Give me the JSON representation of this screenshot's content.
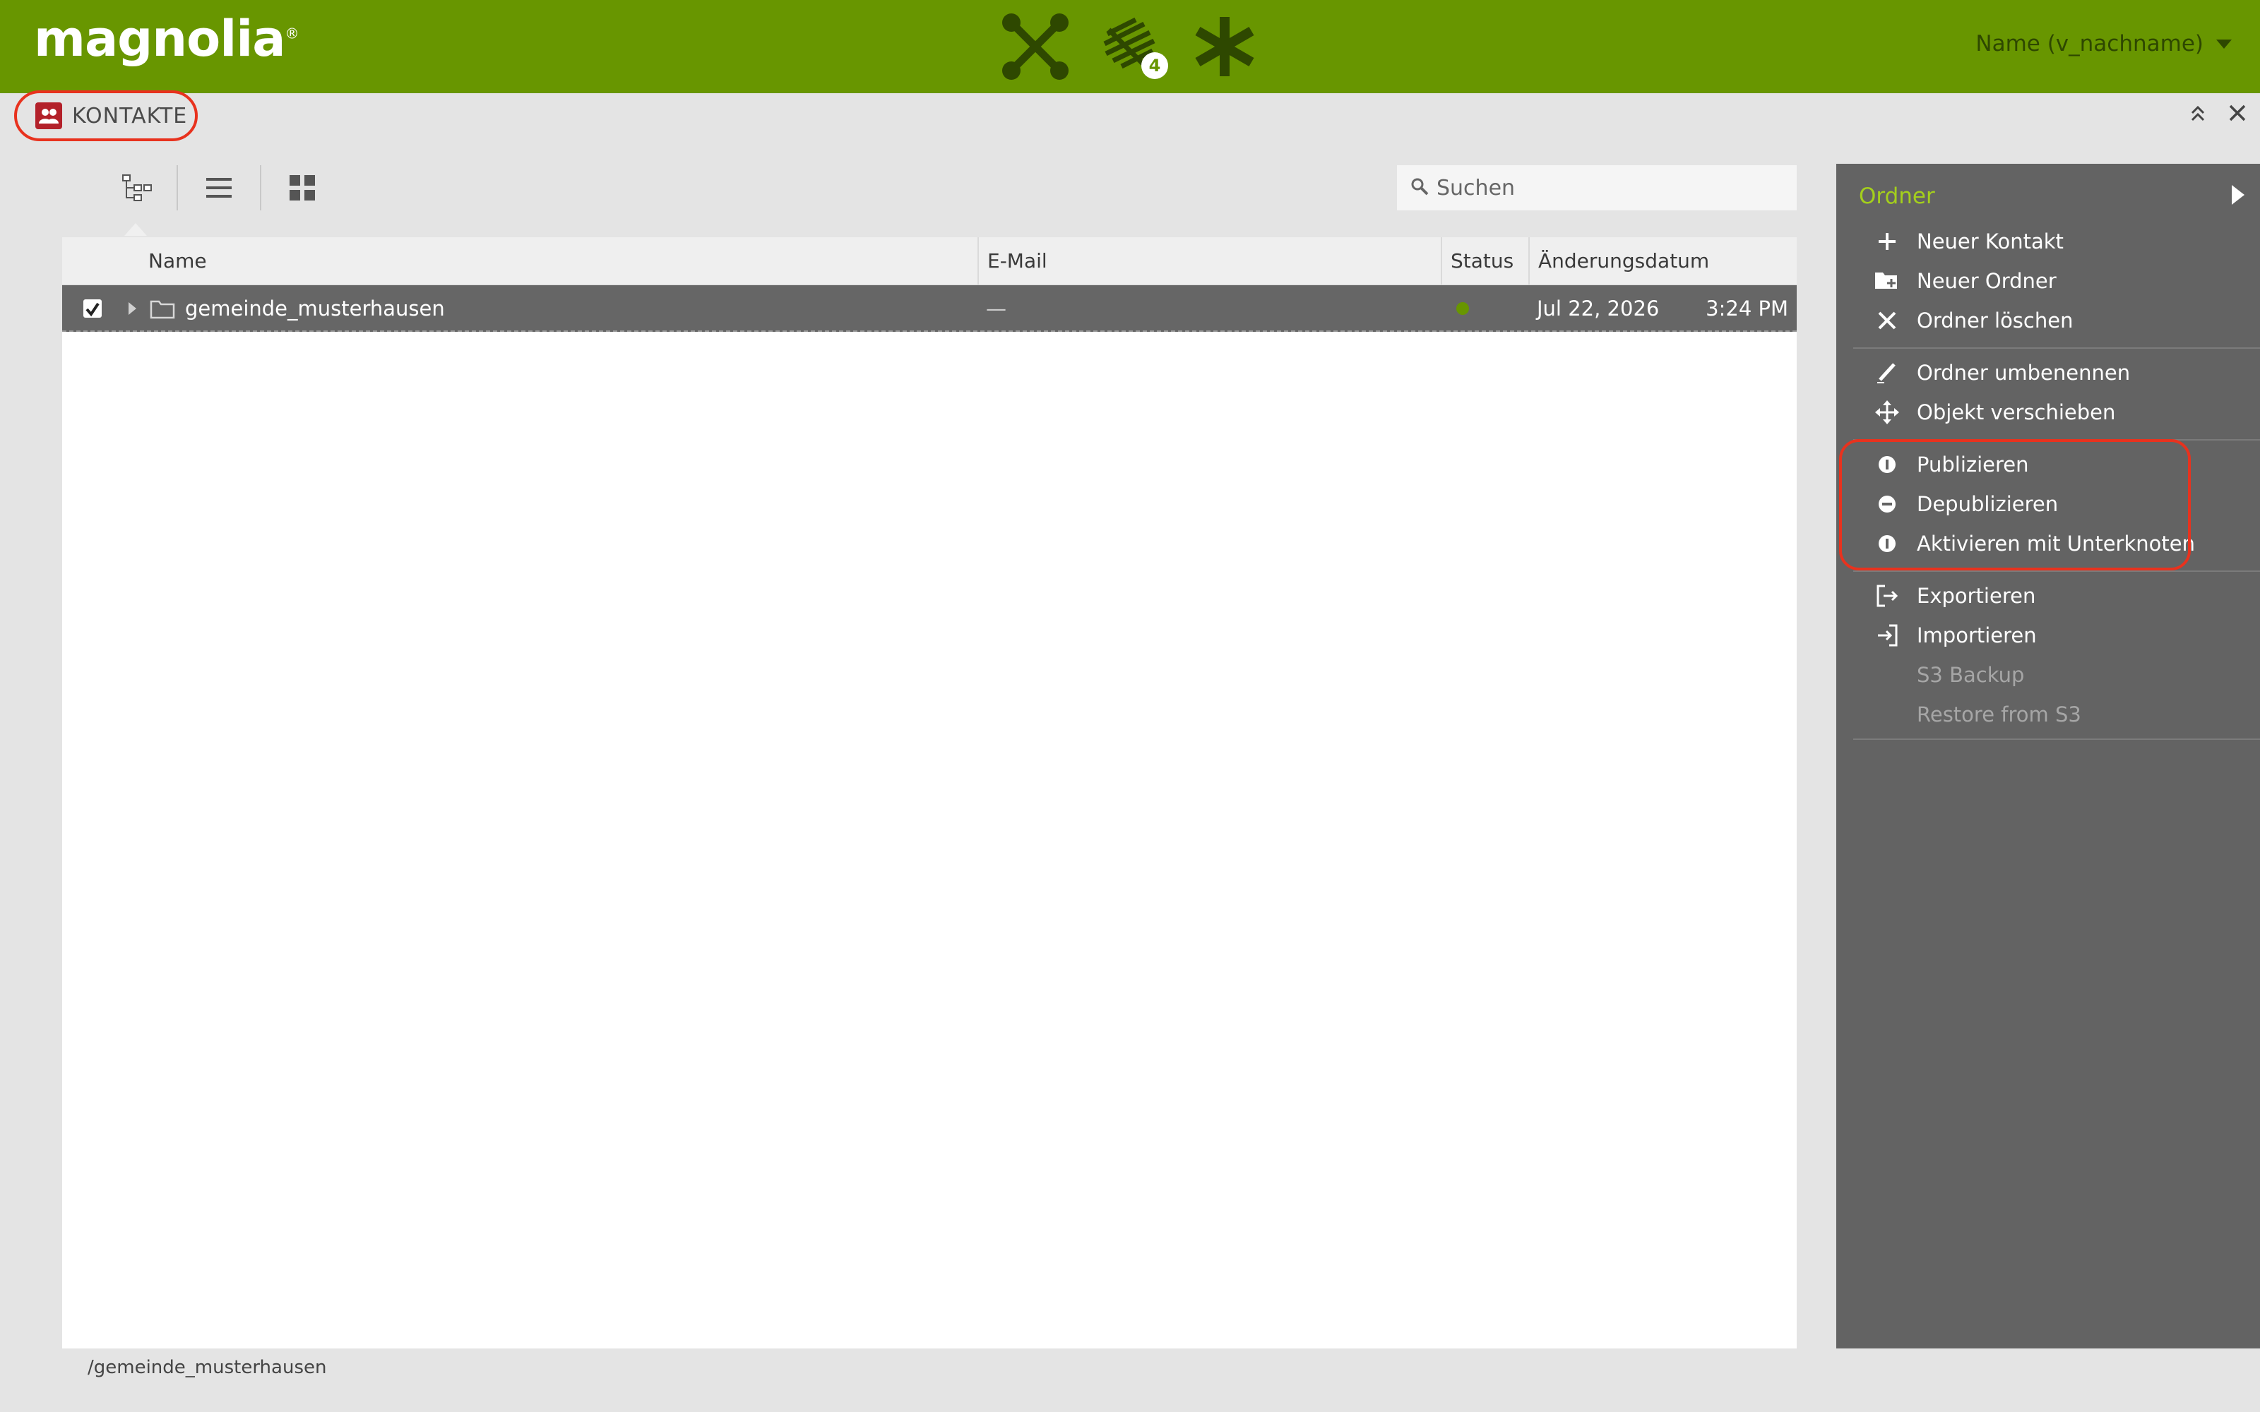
{
  "topbar": {
    "logo_text": "magnolia",
    "logo_mark": "®",
    "apps": [
      {
        "icon": "tools-cross-icon"
      },
      {
        "icon": "pulse-tasks-icon",
        "badge": "4"
      },
      {
        "icon": "asterisk-favorites-icon"
      }
    ],
    "user_name": "Name (v_nachname)",
    "colors": {
      "bar": "#689600",
      "icon": "#2e4800"
    }
  },
  "app_header": {
    "title": "KONTAKTE",
    "icon": "contacts-icon",
    "icon_color": "#b3212a"
  },
  "view_switcher": {
    "views": [
      "tree-view-icon",
      "list-view-icon",
      "thumbnail-view-icon"
    ],
    "active": "tree-view-icon"
  },
  "search": {
    "placeholder": "Suchen",
    "value": ""
  },
  "grid": {
    "columns": [
      "Name",
      "E-Mail",
      "Status",
      "Änderungsdatum"
    ],
    "rows": [
      {
        "selected": true,
        "name": "gemeinde_musterhausen",
        "email": "—",
        "status": "published",
        "status_color": "#689600",
        "date": "Jul 22, 2026",
        "time": "3:24 PM"
      }
    ]
  },
  "footer": {
    "path": "/gemeinde_musterhausen"
  },
  "actionbar": {
    "section_title": "Ordner",
    "groups": [
      [
        {
          "label": "Neuer Kontakt",
          "icon": "add-icon",
          "enabled": true
        },
        {
          "label": "Neuer Ordner",
          "icon": "add-folder-icon",
          "enabled": true
        },
        {
          "label": "Ordner löschen",
          "icon": "delete-icon",
          "enabled": true
        }
      ],
      [
        {
          "label": "Ordner umbenennen",
          "icon": "edit-icon",
          "enabled": true
        },
        {
          "label": "Objekt verschieben",
          "icon": "move-icon",
          "enabled": true
        }
      ],
      [
        {
          "label": "Publizieren",
          "icon": "publish-icon",
          "enabled": true
        },
        {
          "label": "Depublizieren",
          "icon": "unpublish-icon",
          "enabled": true
        },
        {
          "label": "Aktivieren mit Unterknoten",
          "icon": "publish-incl-subnodes-icon",
          "enabled": true
        }
      ],
      [
        {
          "label": "Exportieren",
          "icon": "export-icon",
          "enabled": true
        },
        {
          "label": "Importieren",
          "icon": "import-icon",
          "enabled": true
        },
        {
          "label": "S3 Backup",
          "icon": "",
          "enabled": false
        },
        {
          "label": "Restore from S3",
          "icon": "",
          "enabled": false
        }
      ]
    ],
    "title_color": "#a4cf1c"
  },
  "annotation_color": "#e8321e"
}
